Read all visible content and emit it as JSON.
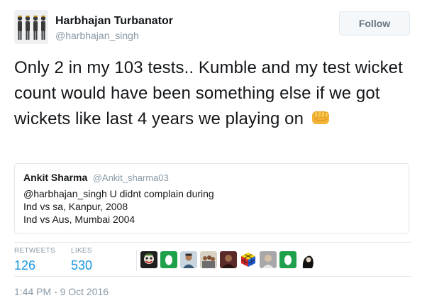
{
  "author": {
    "display_name": "Harbhajan Turbanator",
    "handle": "@harbhajan_singh",
    "avatar_icon": "avatar-photo-icon"
  },
  "follow_button": {
    "label": "Follow"
  },
  "tweet": {
    "text": "Only 2 in my 103 tests.. Kumble and my test wicket count would have been something else if we got wickets like last 4 years we playing on",
    "emoji_icon": "oncoming-fist-icon"
  },
  "quoted_tweet": {
    "author_name": "Ankit Sharma",
    "author_handle": "@Ankit_sharma03",
    "lines": [
      "@harbhajan_singh U didnt complain during",
      "Ind vs sa, Kanpur, 2008",
      "Ind vs Aus, Mumbai 2004"
    ]
  },
  "stats": {
    "retweets_label": "RETWEETS",
    "retweets_count": "126",
    "likes_label": "LIKES",
    "likes_count": "530"
  },
  "likers": [
    {
      "icon": "joker-avatar-icon"
    },
    {
      "icon": "green-egg-avatar-icon"
    },
    {
      "icon": "person-avatar-icon"
    },
    {
      "icon": "group-avatar-icon"
    },
    {
      "icon": "person-avatar-icon"
    },
    {
      "icon": "rubiks-cube-avatar-icon"
    },
    {
      "icon": "person-avatar-icon"
    },
    {
      "icon": "green-egg-avatar-icon"
    },
    {
      "icon": "person-avatar-icon"
    }
  ],
  "timestamp": "1:44 PM - 9 Oct 2016"
}
